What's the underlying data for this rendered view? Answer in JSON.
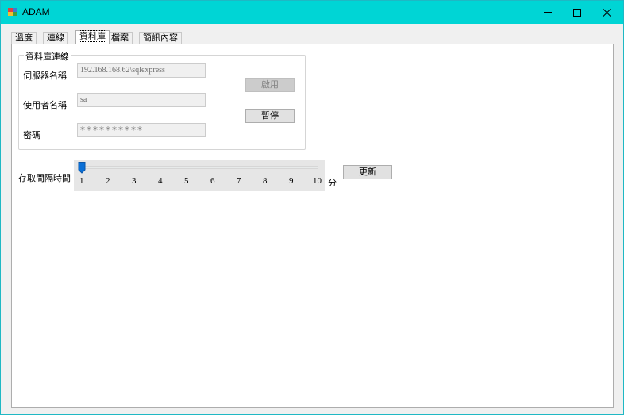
{
  "window": {
    "title": "ADAM"
  },
  "tabs": [
    {
      "label": "溫度"
    },
    {
      "label": "連線"
    },
    {
      "label": "資料庫"
    },
    {
      "label": "檔案"
    },
    {
      "label": "簡訊內容"
    }
  ],
  "db_group": {
    "title": "資料庫連線",
    "server_label": "伺服器名稱",
    "server_value": "192.168.168.62\\sqlexpress",
    "user_label": "使用者名稱",
    "user_value": "sa",
    "password_label": "密碼",
    "password_value": "**********",
    "enable_button": "啟用",
    "pause_button": "暫停"
  },
  "interval": {
    "label": "存取間隔時間",
    "value": 1,
    "ticks": [
      "1",
      "2",
      "3",
      "4",
      "5",
      "6",
      "7",
      "8",
      "9",
      "10"
    ],
    "unit": "分",
    "update_button": "更新"
  },
  "colors": {
    "titlebar": "#00d5d5",
    "slider_thumb": "#0a6fd6"
  }
}
